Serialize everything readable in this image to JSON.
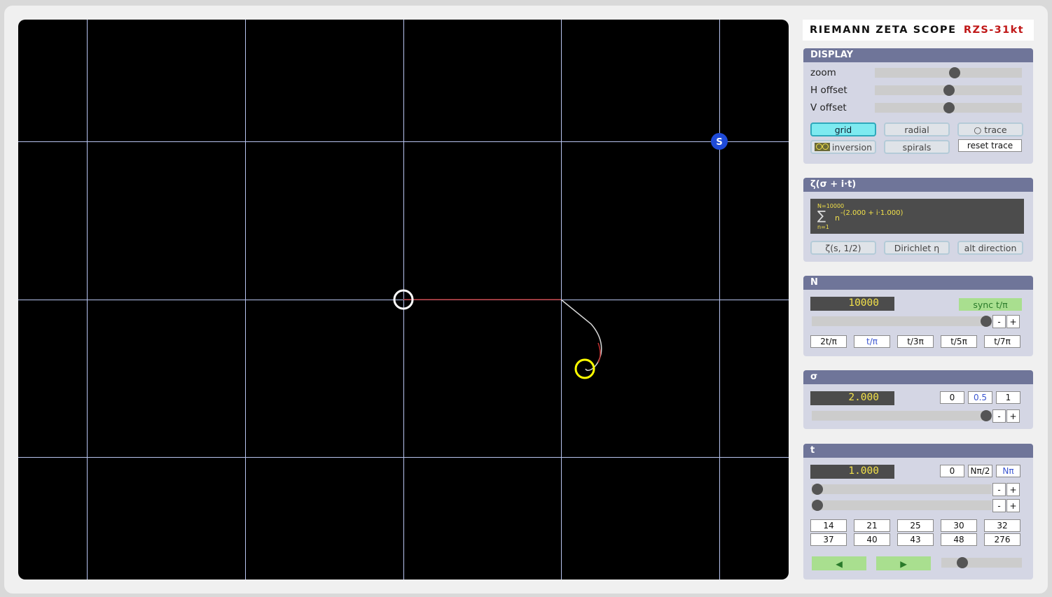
{
  "header": {
    "title": "RIEMANN ZETA SCOPE",
    "code": "RZS-31kt"
  },
  "scope": {
    "s_marker": "S"
  },
  "display": {
    "title": "DISPLAY",
    "zoom_label": "zoom",
    "zoom_level": 0.54,
    "hoffset_label": "H offset",
    "hoffset_level": 0.5,
    "voffset_label": "V offset",
    "voffset_level": 0.5,
    "grid": "grid",
    "radial": "radial",
    "trace": "○ trace",
    "inversion": "inversion",
    "spirals": "spirals",
    "reset_trace": "reset trace"
  },
  "zeta": {
    "title": "ζ(σ + i·t)",
    "upper": "N=10000",
    "sigma_sym": "∑",
    "base": "n",
    "exponent": "-(2.000 + i·1.000)",
    "lower": "n=1",
    "btn1": "ζ(s, 1/2)",
    "btn2": "Dirichlet η",
    "btn3": "alt direction"
  },
  "n_panel": {
    "title": "N",
    "value": "10000",
    "sync": "sync t/π",
    "slider_level": 1.0,
    "minus": "-",
    "plus": "+",
    "presets": [
      "2t/π",
      "t/π",
      "t/3π",
      "t/5π",
      "t/7π"
    ]
  },
  "sigma": {
    "title": "σ",
    "value": "2.000",
    "presets": [
      "0",
      "0.5",
      "1"
    ],
    "slider_level": 1.0,
    "minus": "-",
    "plus": "+"
  },
  "t_panel": {
    "title": "t",
    "value": "1.000",
    "presets": [
      "0",
      "Nπ/2",
      "Nπ"
    ],
    "slider1_level": 0.0,
    "slider2_level": 0.0,
    "minus": "-",
    "plus": "+",
    "zeros_row1": [
      "14",
      "21",
      "25",
      "30",
      "32"
    ],
    "zeros_row2": [
      "37",
      "40",
      "43",
      "48",
      "276"
    ],
    "left": "◀",
    "right": "▶",
    "speed_level": 0.28
  },
  "colors": {
    "accent": "#6f7599",
    "highlight": "#7eeaf0",
    "trace_yellow": "#ffff00",
    "s_marker": "#1f4bd8"
  }
}
